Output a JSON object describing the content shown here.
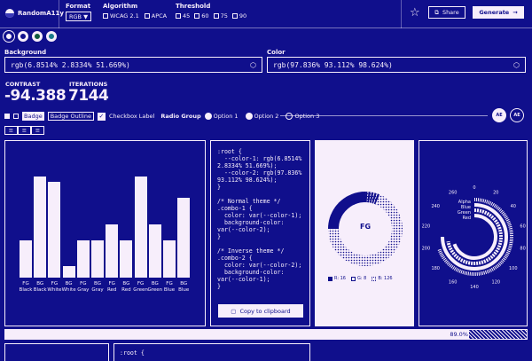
{
  "app": {
    "title": "RandomA11y"
  },
  "controls": {
    "format_label": "Format",
    "format_value": "RGB ▼",
    "algorithm_label": "Algorithm",
    "algorithm_options": [
      "WCAG 2.1",
      "APCA"
    ],
    "threshold_label": "Threshold",
    "threshold_options": [
      "45",
      "60",
      "75",
      "90"
    ]
  },
  "toolbar": {
    "share_label": "Share",
    "generate_label": "Generate"
  },
  "background": {
    "label": "Background",
    "value": "rgb(6.8514% 2.8334% 51.669%)"
  },
  "color": {
    "label": "Color",
    "value": "rgb(97.836% 93.112% 98.624%)"
  },
  "stats": {
    "contrast_label": "CONTRAST",
    "contrast_value": "-94.388",
    "iterations_label": "ITERATIONS",
    "iterations_value": "7144"
  },
  "components": {
    "badge": "Badge",
    "badge_outline": "Badge Outline",
    "checkbox_label": "Checkbox Label",
    "radio_group_label": "Radio Group",
    "radio_options": [
      "Option 1",
      "Option 2",
      "Option 3"
    ],
    "avatar_labels": [
      "AE",
      "AE"
    ]
  },
  "bars": {
    "values": [
      0.35,
      0.95,
      0.9,
      0.11,
      0.35,
      0.35,
      0.5,
      0.35,
      0.95,
      0.5,
      0.35,
      0.75
    ],
    "labels": [
      [
        "FG",
        "Black"
      ],
      [
        "BG",
        "Black"
      ],
      [
        "FG",
        "White"
      ],
      [
        "BG",
        "White"
      ],
      [
        "FG",
        "Gray"
      ],
      [
        "BG",
        "Gray"
      ],
      [
        "FG",
        "Red"
      ],
      [
        "BG",
        "Red"
      ],
      [
        "FG",
        "Green"
      ],
      [
        "BG",
        "Green"
      ],
      [
        "FG",
        "Blue"
      ],
      [
        "BG",
        "Blue"
      ]
    ]
  },
  "code": {
    "text": ":root {\n  --color-1: rgb(6.8514% 2.8334% 51.669%);\n  --color-2: rgb(97.836% 93.112% 98.624%);\n}\n\n/* Normal theme */\n.combo-1 {\n  color: var(--color-1);\n  background-color: var(--color-2);\n}\n\n/* Inverse theme */\n.combo-2 {\n  color: var(--color-2);\n  background-color: var(--color-1);\n}",
    "copy_label": "Copy to clipboard",
    "bottom_text": ":root {"
  },
  "donut": {
    "center_label": "FG",
    "legend": [
      "R: 16",
      "G: 8",
      "B: 126"
    ]
  },
  "radial": {
    "legend": [
      "Alpha",
      "Blue",
      "Green",
      "Red"
    ],
    "ticks": [
      "0",
      "20",
      "40",
      "60",
      "80",
      "100",
      "120",
      "140",
      "160",
      "180",
      "200",
      "220",
      "240",
      "260"
    ]
  },
  "progress": {
    "value": "89.0%",
    "fraction": 0.89
  }
}
